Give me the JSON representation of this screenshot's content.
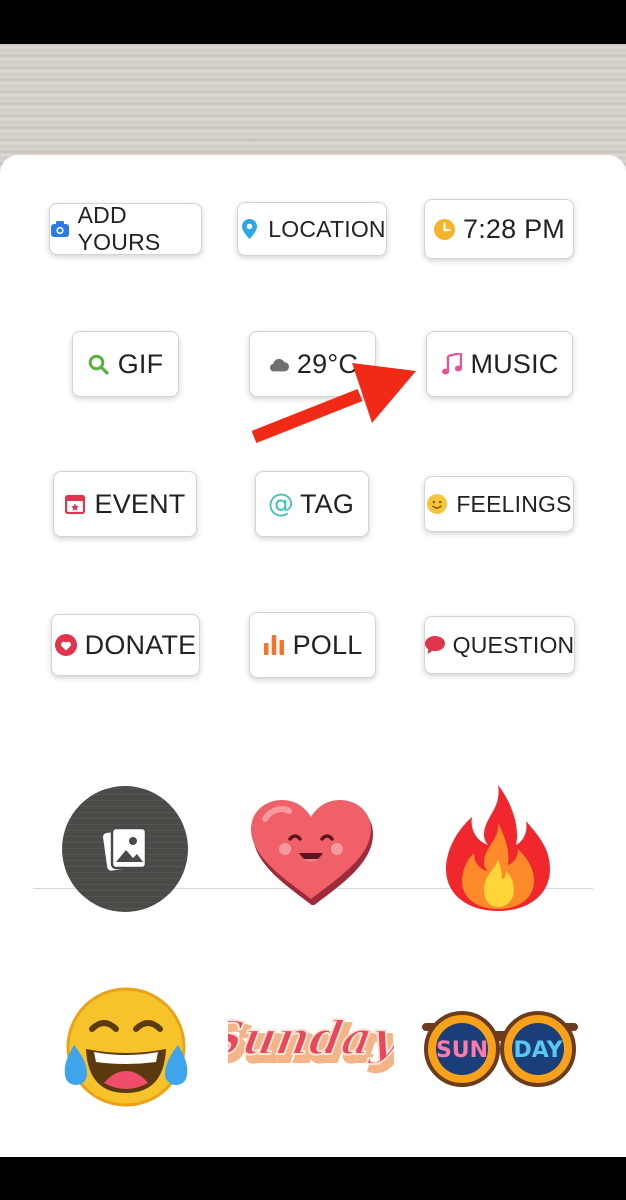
{
  "stickers_row1": [
    {
      "label": "ADD YOURS",
      "icon": "camera-icon"
    },
    {
      "label": "LOCATION",
      "icon": "location-pin-icon"
    },
    {
      "label": "7:28 PM",
      "icon": "clock-icon"
    }
  ],
  "stickers_row2": [
    {
      "label": "GIF",
      "icon": "search-icon"
    },
    {
      "label": "29°C",
      "icon": "cloud-icon"
    },
    {
      "label": "MUSIC",
      "icon": "music-note-icon"
    }
  ],
  "stickers_row3": [
    {
      "label": "EVENT",
      "icon": "calendar-icon"
    },
    {
      "label": "TAG",
      "icon": "at-icon"
    },
    {
      "label": "FEELINGS",
      "icon": "smiley-icon"
    }
  ],
  "stickers_row4": [
    {
      "label": "DONATE",
      "icon": "donate-icon"
    },
    {
      "label": "POLL",
      "icon": "poll-bars-icon"
    },
    {
      "label": "QUESTION",
      "icon": "speech-bubble-icon"
    }
  ],
  "graphic_stickers": {
    "sunday_text": "Sunday",
    "sun_text": "SUN",
    "day_text": "DAY"
  },
  "colors": {
    "arrow": "#f02a17",
    "music": "#e0569d",
    "location": "#2aa7e8",
    "clock": "#f5b42a",
    "gif": "#59b041",
    "event": "#e0344d",
    "tag": "#3ec2b7",
    "poll": "#f5722a",
    "question": "#e0344d"
  }
}
